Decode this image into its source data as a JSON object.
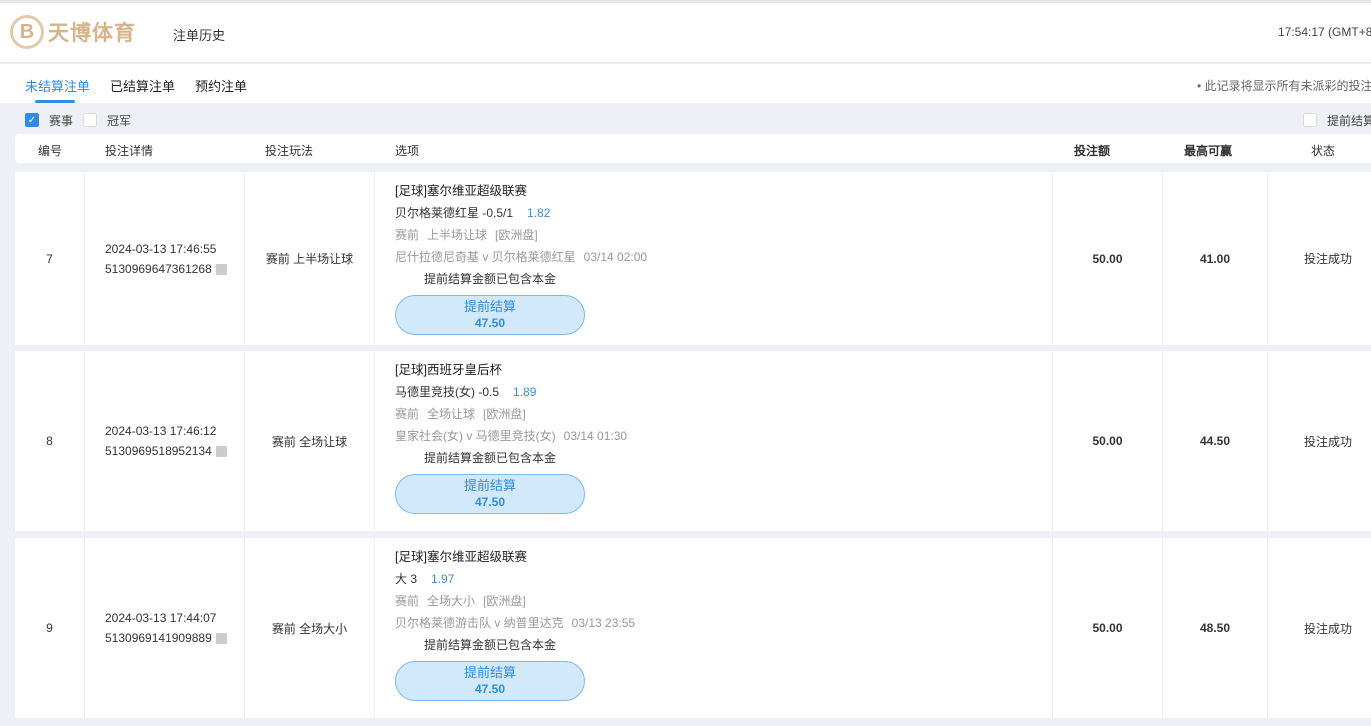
{
  "header": {
    "logo_text": "天博体育",
    "logo_mark": "B",
    "title": "注单历史",
    "clock": "17:54:17 (GMT+8"
  },
  "tabs": [
    {
      "label": "未结算注单"
    },
    {
      "label": "已结算注单"
    },
    {
      "label": "预约注单"
    }
  ],
  "note": "• 此记录将显示所有未派彩的投注",
  "filters": {
    "event": "赛事",
    "outright": "冠军",
    "cashout_only": "提前结算"
  },
  "columns": [
    "编号",
    "投注详情",
    "投注玩法",
    "选项",
    "投注额",
    "最高可赢",
    "状态"
  ],
  "rows": [
    {
      "no": "7",
      "time": "2024-03-13 17:46:55",
      "id": "5130969647361268",
      "type": "赛前 上半场让球",
      "league": "[足球]塞尔维亚超级联赛",
      "pick": "贝尔格莱德红星 -0.5/1",
      "odds": "1.82",
      "stage": "赛前",
      "market": "上半场让球",
      "odds_type": "[欧洲盘]",
      "match": "尼什拉德尼奇基 v 贝尔格莱德红星",
      "kickoff": "03/14 02:00",
      "included": "提前结算金额已包含本金",
      "cashout_label": "提前结算",
      "cashout_value": "47.50",
      "stake": "50.00",
      "max_win": "41.00",
      "status": "投注成功"
    },
    {
      "no": "8",
      "time": "2024-03-13 17:46:12",
      "id": "5130969518952134",
      "type": "赛前 全场让球",
      "league": "[足球]西班牙皇后杯",
      "pick": "马德里竞技(女) -0.5",
      "odds": "1.89",
      "stage": "赛前",
      "market": "全场让球",
      "odds_type": "[欧洲盘]",
      "match": "皇家社会(女) v 马德里竞技(女)",
      "kickoff": "03/14 01:30",
      "included": "提前结算金额已包含本金",
      "cashout_label": "提前结算",
      "cashout_value": "47.50",
      "stake": "50.00",
      "max_win": "44.50",
      "status": "投注成功"
    },
    {
      "no": "9",
      "time": "2024-03-13 17:44:07",
      "id": "5130969141909889",
      "type": "赛前 全场大小",
      "league": "[足球]塞尔维亚超级联赛",
      "pick": "大 3",
      "odds": "1.97",
      "stage": "赛前",
      "market": "全场大小",
      "odds_type": "[欧洲盘]",
      "match": "贝尔格莱德游击队 v 纳普里达克",
      "kickoff": "03/13 23:55",
      "included": "提前结算金额已包含本金",
      "cashout_label": "提前结算",
      "cashout_value": "47.50",
      "stake": "50.00",
      "max_win": "48.50",
      "status": "投注成功"
    }
  ]
}
